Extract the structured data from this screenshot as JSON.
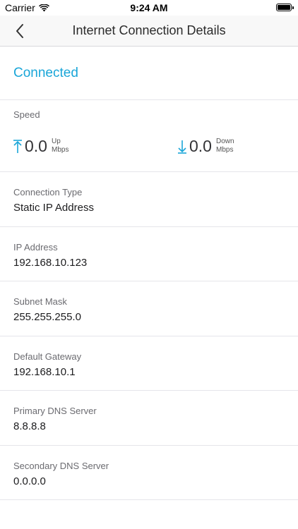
{
  "status_bar": {
    "carrier": "Carrier",
    "time": "9:24 AM"
  },
  "nav": {
    "title": "Internet Connection Details",
    "back_icon": "chevron-left-icon"
  },
  "connection_status": "Connected",
  "speed": {
    "label": "Speed",
    "up": {
      "value": "0.0",
      "direction": "Up",
      "unit": "Mbps"
    },
    "down": {
      "value": "0.0",
      "direction": "Down",
      "unit": "Mbps"
    }
  },
  "details": [
    {
      "label": "Connection Type",
      "value": "Static IP Address"
    },
    {
      "label": "IP Address",
      "value": "192.168.10.123"
    },
    {
      "label": "Subnet Mask",
      "value": "255.255.255.0"
    },
    {
      "label": "Default Gateway",
      "value": "192.168.10.1"
    },
    {
      "label": "Primary DNS Server",
      "value": "8.8.8.8"
    },
    {
      "label": "Secondary DNS Server",
      "value": "0.0.0.0"
    }
  ],
  "colors": {
    "accent": "#1aa6d8",
    "separator": "#e5e5ea",
    "nav_background": "#f8f8f8"
  }
}
